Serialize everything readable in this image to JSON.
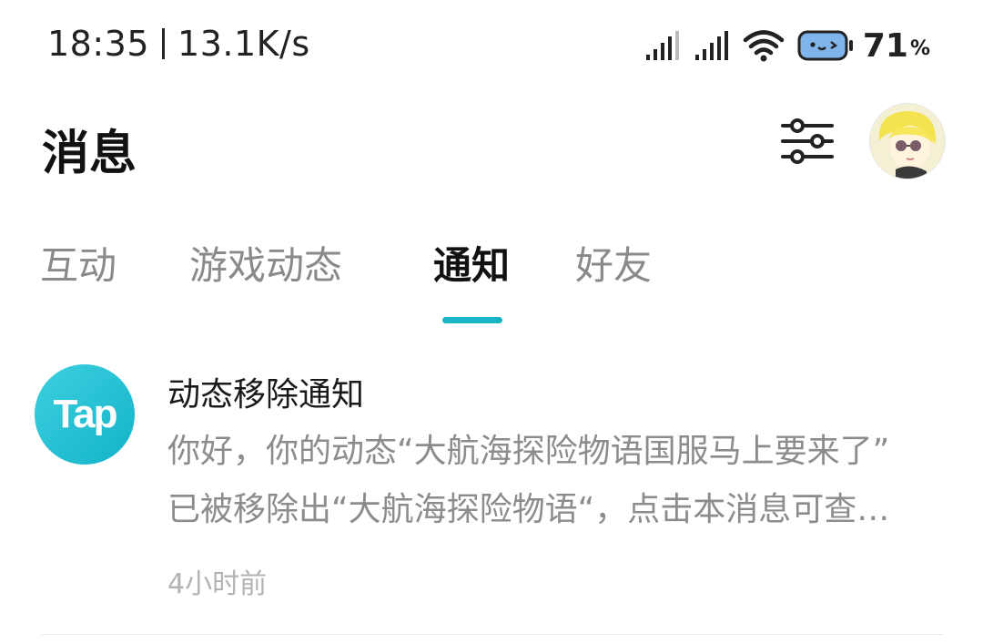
{
  "status_bar": {
    "time": "18:35",
    "net_speed": "13.1K/s",
    "battery_level": "71",
    "battery_unit": "%",
    "icons": [
      "signal-icon",
      "signal-icon",
      "wifi-icon",
      "battery-icon"
    ]
  },
  "header": {
    "title": "消息",
    "filter_icon": "sliders-icon",
    "avatar_icon": "avatar"
  },
  "tabs": [
    {
      "label": "互动",
      "active": false
    },
    {
      "label": "游戏动态",
      "active": false
    },
    {
      "label": "通知",
      "active": true
    },
    {
      "label": "好友",
      "active": false
    }
  ],
  "notifications": [
    {
      "logo_text": "Tap",
      "title": "动态移除通知",
      "body_line1": "你好，你的动态“大航海探险物语国服马上要来了”",
      "body_line2": "已被移除出“大航海探险物语“，点击本消息可查…",
      "time": "4小时前"
    }
  ],
  "colors": {
    "accent": "#1ab5c4",
    "tap_logo": "#14b3c8"
  }
}
